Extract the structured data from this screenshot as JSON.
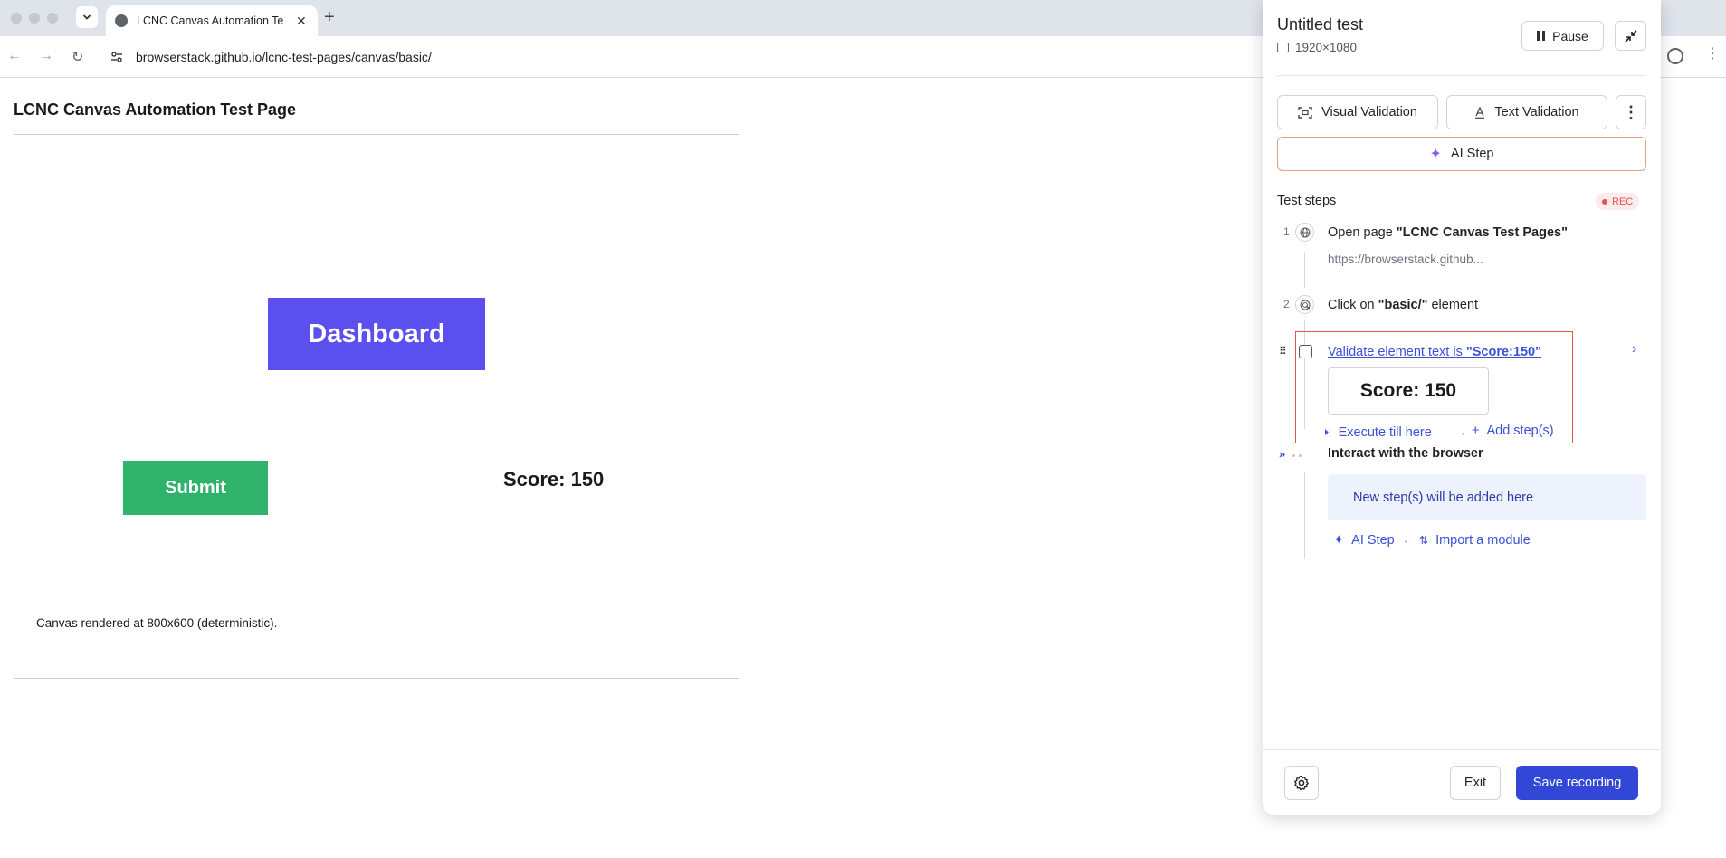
{
  "browser": {
    "tab_title": "LCNC Canvas Automation Te",
    "url": "browserstack.github.io/lcnc-test-pages/canvas/basic/"
  },
  "page": {
    "title": "LCNC Canvas Automation Test Page",
    "canvas": {
      "dashboard_label": "Dashboard",
      "submit_label": "Submit",
      "score_text": "Score: 150",
      "note": "Canvas rendered at 800x600 (deterministic)."
    }
  },
  "recorder": {
    "title": "Untitled test",
    "resolution": "1920×1080",
    "pause_label": "Pause",
    "visual_validation_label": "Visual Validation",
    "text_validation_label": "Text Validation",
    "ai_step_label": "AI Step",
    "steps_heading": "Test steps",
    "rec_badge": "REC",
    "steps": [
      {
        "number": "1",
        "prefix": "Open page ",
        "target": "\"LCNC Canvas Test Pages\"",
        "suffix": "",
        "sub": "https://browserstack.github..."
      },
      {
        "number": "2",
        "prefix": "Click on ",
        "target": "\"basic/\"",
        "suffix": " element"
      },
      {
        "prefix": "Validate element text is ",
        "target": "\"Score:150\"",
        "preview": "Score: 150",
        "execute_label": "Execute till here",
        "add_label": "Add step(s)"
      }
    ],
    "interact_label": "Interact with the browser",
    "new_steps_text": "New step(s) will be added here",
    "ai_step_link": "AI Step",
    "import_link": "Import a module",
    "exit_label": "Exit",
    "save_label": "Save recording"
  },
  "colors": {
    "dashboard": "#5b4ff0",
    "submit": "#2fb36b",
    "primary": "#3347d6",
    "highlight": "#e5534b"
  }
}
